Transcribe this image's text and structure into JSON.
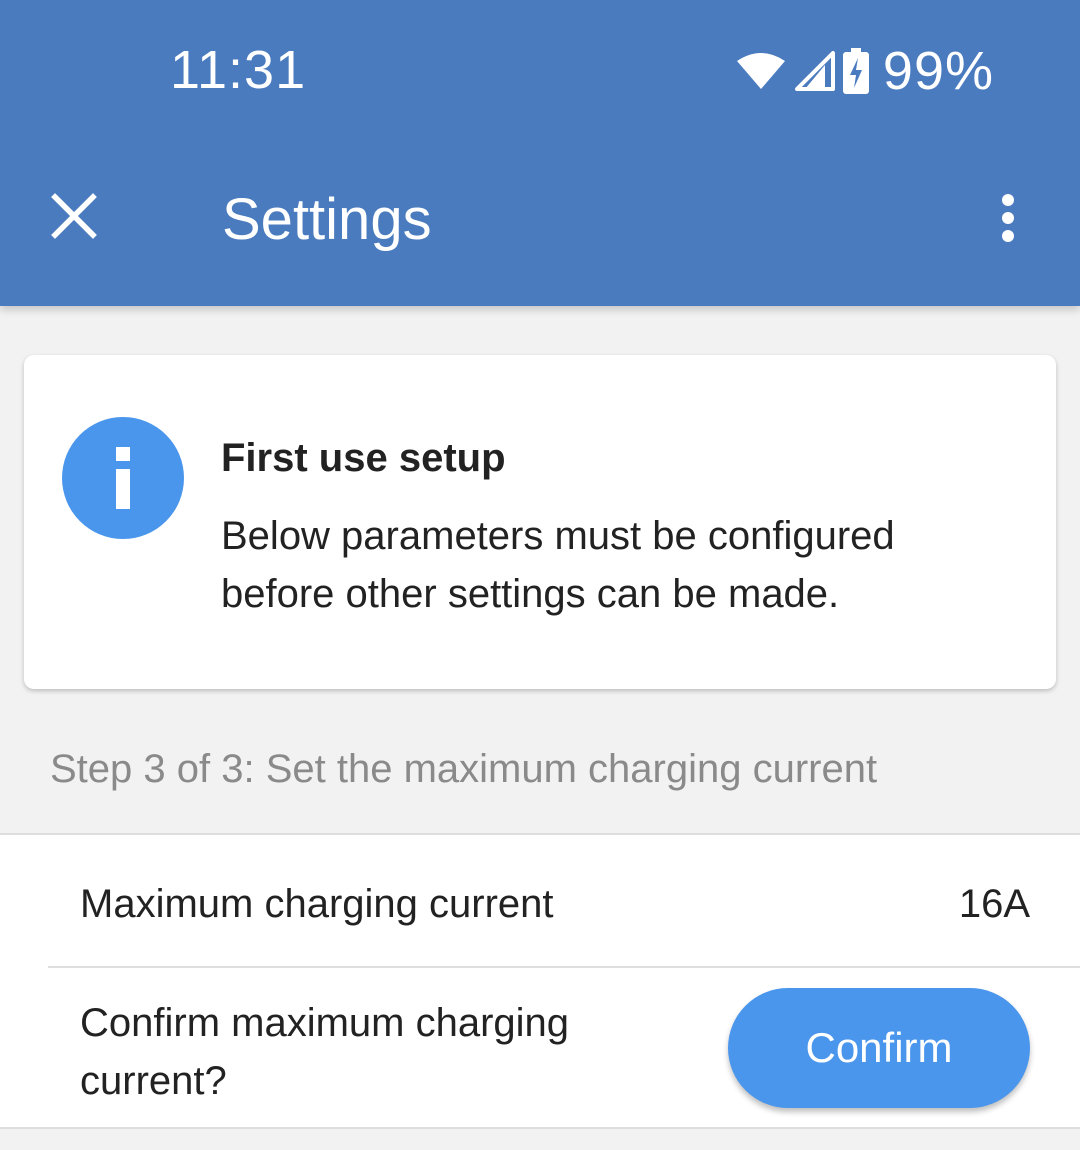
{
  "status_bar": {
    "time": "11:31",
    "battery_percent": "99%",
    "icons": [
      "wifi-icon",
      "cell-signal-icon",
      "battery-charging-icon"
    ]
  },
  "app_bar": {
    "title": "Settings",
    "close_icon": "close-icon",
    "menu_icon": "more-vert-icon",
    "color": "#4a7bbf"
  },
  "info_card": {
    "icon": "info-icon",
    "icon_color": "#4a96ec",
    "title": "First use setup",
    "body": "Below parameters must be configured before other settings can be made."
  },
  "step": {
    "label": "Step 3 of 3: Set the maximum charging current"
  },
  "settings": {
    "max_current": {
      "label": "Maximum charging current",
      "value": "16A"
    },
    "confirm": {
      "label": "Confirm maximum charging current?",
      "button_label": "Confirm",
      "button_color": "#4a96ec"
    }
  }
}
